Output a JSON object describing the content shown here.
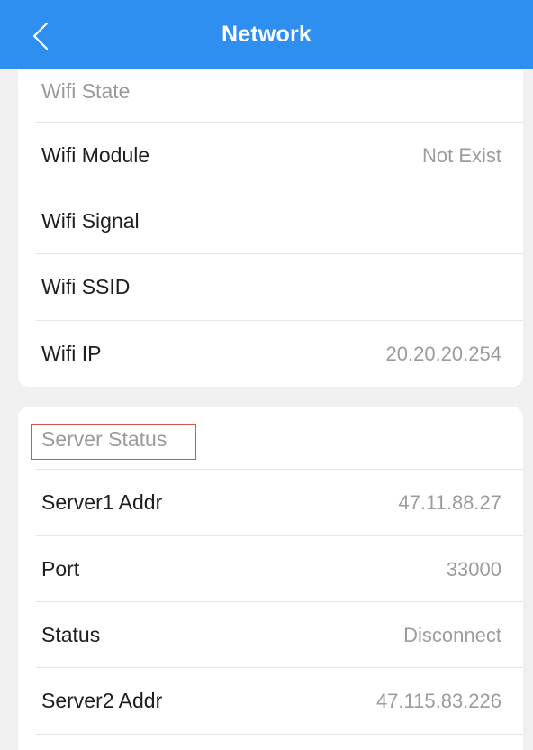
{
  "header": {
    "title": "Network",
    "back_icon": "chevron-left-icon",
    "bg_color": "#2f8ff0"
  },
  "wifi": {
    "section_title": "Wifi State",
    "rows": [
      {
        "label": "Wifi Module",
        "value": "Not Exist"
      },
      {
        "label": "Wifi Signal",
        "value": ""
      },
      {
        "label": "Wifi SSID",
        "value": ""
      },
      {
        "label": "Wifi IP",
        "value": "20.20.20.254"
      }
    ]
  },
  "server": {
    "section_title": "Server Status",
    "rows": [
      {
        "label": "Server1 Addr",
        "value": "47.11.88.27"
      },
      {
        "label": "Port",
        "value": "33000"
      },
      {
        "label": "Status",
        "value": "Disconnect"
      },
      {
        "label": "Server2 Addr",
        "value": "47.115.83.226"
      }
    ]
  }
}
